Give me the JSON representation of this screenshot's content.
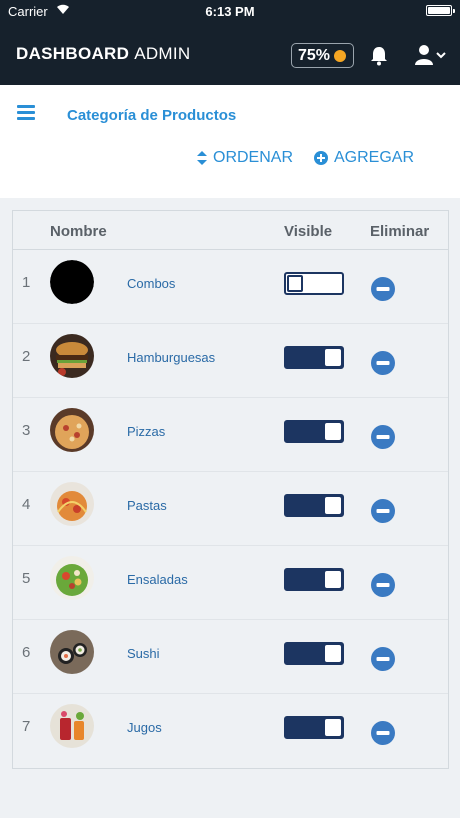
{
  "status": {
    "carrier": "Carrier",
    "time": "6:13 PM"
  },
  "header": {
    "brand_bold": "DASHBOARD",
    "brand_light": "ADMIN",
    "progress_label": "75%",
    "progress_percent": 75,
    "dot_color": "#f5a623",
    "bg_color": "#16212c"
  },
  "subheader": {
    "title": "Categoría de Productos",
    "order_label": "ORDENAR",
    "add_label": "AGREGAR",
    "accent_color": "#2a8fd6"
  },
  "table": {
    "columns": {
      "name": "Nombre",
      "visible": "Visible",
      "delete": "Eliminar"
    },
    "rows": [
      {
        "num": "1",
        "name": "Combos",
        "visible": false,
        "image": "black-circle"
      },
      {
        "num": "2",
        "name": "Hamburguesas",
        "visible": true,
        "image": "burger-photo"
      },
      {
        "num": "3",
        "name": "Pizzas",
        "visible": true,
        "image": "pizza-photo"
      },
      {
        "num": "4",
        "name": "Pastas",
        "visible": true,
        "image": "pasta-photo"
      },
      {
        "num": "5",
        "name": "Ensaladas",
        "visible": true,
        "image": "salad-photo"
      },
      {
        "num": "6",
        "name": "Sushi",
        "visible": true,
        "image": "sushi-photo"
      },
      {
        "num": "7",
        "name": "Jugos",
        "visible": true,
        "image": "juice-photo"
      }
    ]
  }
}
